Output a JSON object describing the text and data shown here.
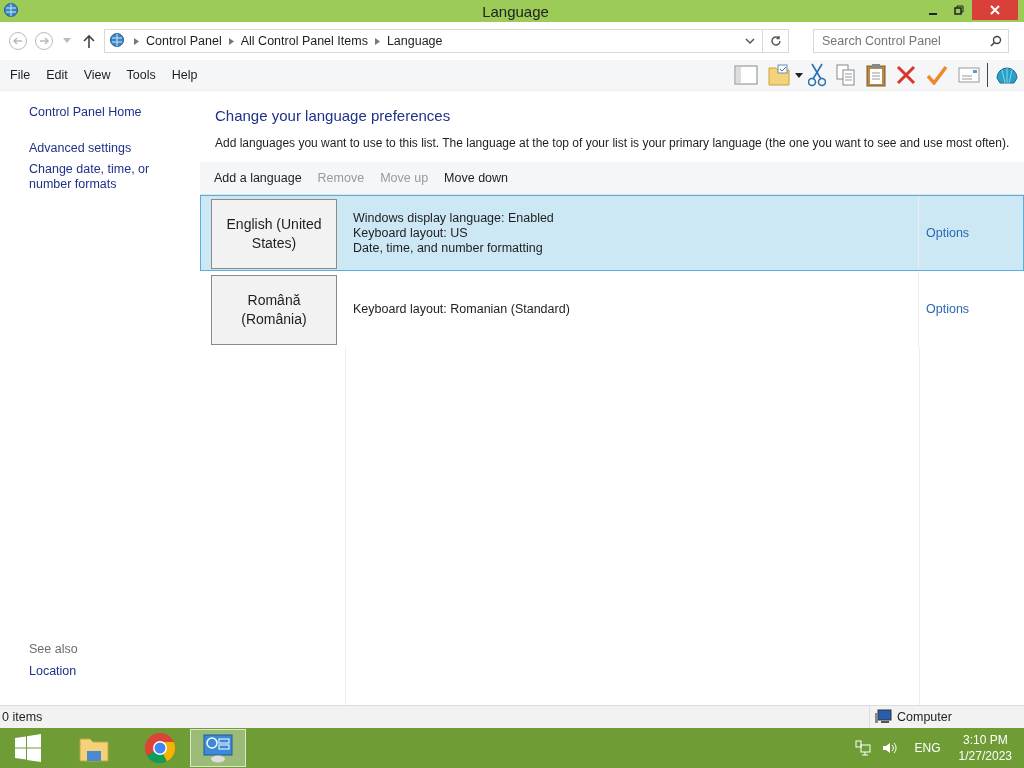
{
  "window": {
    "title": "Language"
  },
  "address": {
    "crumbs": [
      "Control Panel",
      "All Control Panel Items",
      "Language"
    ]
  },
  "search": {
    "placeholder": "Search Control Panel"
  },
  "menu": [
    "File",
    "Edit",
    "View",
    "Tools",
    "Help"
  ],
  "sidebar": {
    "links": [
      "Control Panel Home",
      "Advanced settings",
      "Change date, time, or number formats"
    ],
    "see_also": "See also",
    "see_also_links": [
      "Location"
    ]
  },
  "main": {
    "heading": "Change your language preferences",
    "description": "Add languages you want to use to this list. The language at the top of your list is your primary language (the one you want to see and use most often).",
    "actions": [
      {
        "label": "Add a language",
        "disabled": false
      },
      {
        "label": "Remove",
        "disabled": true
      },
      {
        "label": "Move up",
        "disabled": true
      },
      {
        "label": "Move down",
        "disabled": false
      }
    ],
    "languages": [
      {
        "name": "English (United States)",
        "selected": true,
        "details": [
          "Windows display language: Enabled",
          "Keyboard layout: US",
          "Date, time, and number formatting"
        ],
        "options": "Options"
      },
      {
        "name": "Română (România)",
        "selected": false,
        "details": [
          "Keyboard layout: Romanian (Standard)"
        ],
        "options": "Options"
      }
    ]
  },
  "status_bar": {
    "items": "0 items",
    "location": "Computer"
  },
  "taskbar": {
    "language": "ENG",
    "time": "3:10 PM",
    "date": "1/27/2023"
  }
}
